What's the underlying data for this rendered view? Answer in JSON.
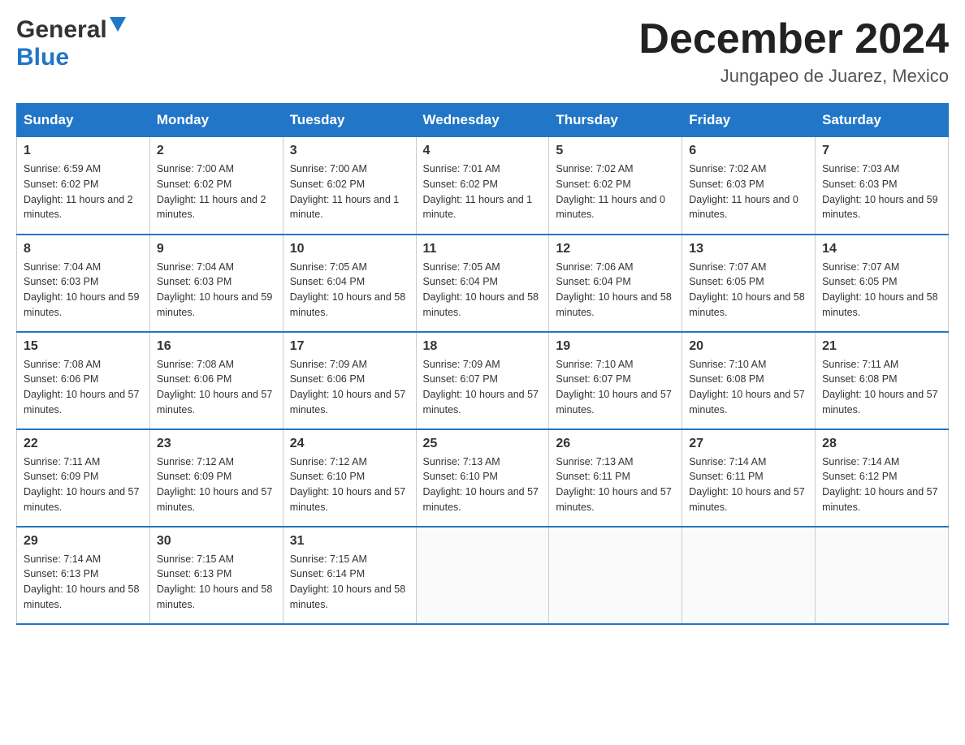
{
  "header": {
    "logo_general": "General",
    "logo_blue": "Blue",
    "month_title": "December 2024",
    "subtitle": "Jungapeo de Juarez, Mexico"
  },
  "days_of_week": [
    "Sunday",
    "Monday",
    "Tuesday",
    "Wednesday",
    "Thursday",
    "Friday",
    "Saturday"
  ],
  "weeks": [
    [
      {
        "day": "1",
        "sunrise": "6:59 AM",
        "sunset": "6:02 PM",
        "daylight": "11 hours and 2 minutes."
      },
      {
        "day": "2",
        "sunrise": "7:00 AM",
        "sunset": "6:02 PM",
        "daylight": "11 hours and 2 minutes."
      },
      {
        "day": "3",
        "sunrise": "7:00 AM",
        "sunset": "6:02 PM",
        "daylight": "11 hours and 1 minute."
      },
      {
        "day": "4",
        "sunrise": "7:01 AM",
        "sunset": "6:02 PM",
        "daylight": "11 hours and 1 minute."
      },
      {
        "day": "5",
        "sunrise": "7:02 AM",
        "sunset": "6:02 PM",
        "daylight": "11 hours and 0 minutes."
      },
      {
        "day": "6",
        "sunrise": "7:02 AM",
        "sunset": "6:03 PM",
        "daylight": "11 hours and 0 minutes."
      },
      {
        "day": "7",
        "sunrise": "7:03 AM",
        "sunset": "6:03 PM",
        "daylight": "10 hours and 59 minutes."
      }
    ],
    [
      {
        "day": "8",
        "sunrise": "7:04 AM",
        "sunset": "6:03 PM",
        "daylight": "10 hours and 59 minutes."
      },
      {
        "day": "9",
        "sunrise": "7:04 AM",
        "sunset": "6:03 PM",
        "daylight": "10 hours and 59 minutes."
      },
      {
        "day": "10",
        "sunrise": "7:05 AM",
        "sunset": "6:04 PM",
        "daylight": "10 hours and 58 minutes."
      },
      {
        "day": "11",
        "sunrise": "7:05 AM",
        "sunset": "6:04 PM",
        "daylight": "10 hours and 58 minutes."
      },
      {
        "day": "12",
        "sunrise": "7:06 AM",
        "sunset": "6:04 PM",
        "daylight": "10 hours and 58 minutes."
      },
      {
        "day": "13",
        "sunrise": "7:07 AM",
        "sunset": "6:05 PM",
        "daylight": "10 hours and 58 minutes."
      },
      {
        "day": "14",
        "sunrise": "7:07 AM",
        "sunset": "6:05 PM",
        "daylight": "10 hours and 58 minutes."
      }
    ],
    [
      {
        "day": "15",
        "sunrise": "7:08 AM",
        "sunset": "6:06 PM",
        "daylight": "10 hours and 57 minutes."
      },
      {
        "day": "16",
        "sunrise": "7:08 AM",
        "sunset": "6:06 PM",
        "daylight": "10 hours and 57 minutes."
      },
      {
        "day": "17",
        "sunrise": "7:09 AM",
        "sunset": "6:06 PM",
        "daylight": "10 hours and 57 minutes."
      },
      {
        "day": "18",
        "sunrise": "7:09 AM",
        "sunset": "6:07 PM",
        "daylight": "10 hours and 57 minutes."
      },
      {
        "day": "19",
        "sunrise": "7:10 AM",
        "sunset": "6:07 PM",
        "daylight": "10 hours and 57 minutes."
      },
      {
        "day": "20",
        "sunrise": "7:10 AM",
        "sunset": "6:08 PM",
        "daylight": "10 hours and 57 minutes."
      },
      {
        "day": "21",
        "sunrise": "7:11 AM",
        "sunset": "6:08 PM",
        "daylight": "10 hours and 57 minutes."
      }
    ],
    [
      {
        "day": "22",
        "sunrise": "7:11 AM",
        "sunset": "6:09 PM",
        "daylight": "10 hours and 57 minutes."
      },
      {
        "day": "23",
        "sunrise": "7:12 AM",
        "sunset": "6:09 PM",
        "daylight": "10 hours and 57 minutes."
      },
      {
        "day": "24",
        "sunrise": "7:12 AM",
        "sunset": "6:10 PM",
        "daylight": "10 hours and 57 minutes."
      },
      {
        "day": "25",
        "sunrise": "7:13 AM",
        "sunset": "6:10 PM",
        "daylight": "10 hours and 57 minutes."
      },
      {
        "day": "26",
        "sunrise": "7:13 AM",
        "sunset": "6:11 PM",
        "daylight": "10 hours and 57 minutes."
      },
      {
        "day": "27",
        "sunrise": "7:14 AM",
        "sunset": "6:11 PM",
        "daylight": "10 hours and 57 minutes."
      },
      {
        "day": "28",
        "sunrise": "7:14 AM",
        "sunset": "6:12 PM",
        "daylight": "10 hours and 57 minutes."
      }
    ],
    [
      {
        "day": "29",
        "sunrise": "7:14 AM",
        "sunset": "6:13 PM",
        "daylight": "10 hours and 58 minutes."
      },
      {
        "day": "30",
        "sunrise": "7:15 AM",
        "sunset": "6:13 PM",
        "daylight": "10 hours and 58 minutes."
      },
      {
        "day": "31",
        "sunrise": "7:15 AM",
        "sunset": "6:14 PM",
        "daylight": "10 hours and 58 minutes."
      },
      null,
      null,
      null,
      null
    ]
  ],
  "labels": {
    "sunrise": "Sunrise:",
    "sunset": "Sunset:",
    "daylight": "Daylight:"
  }
}
